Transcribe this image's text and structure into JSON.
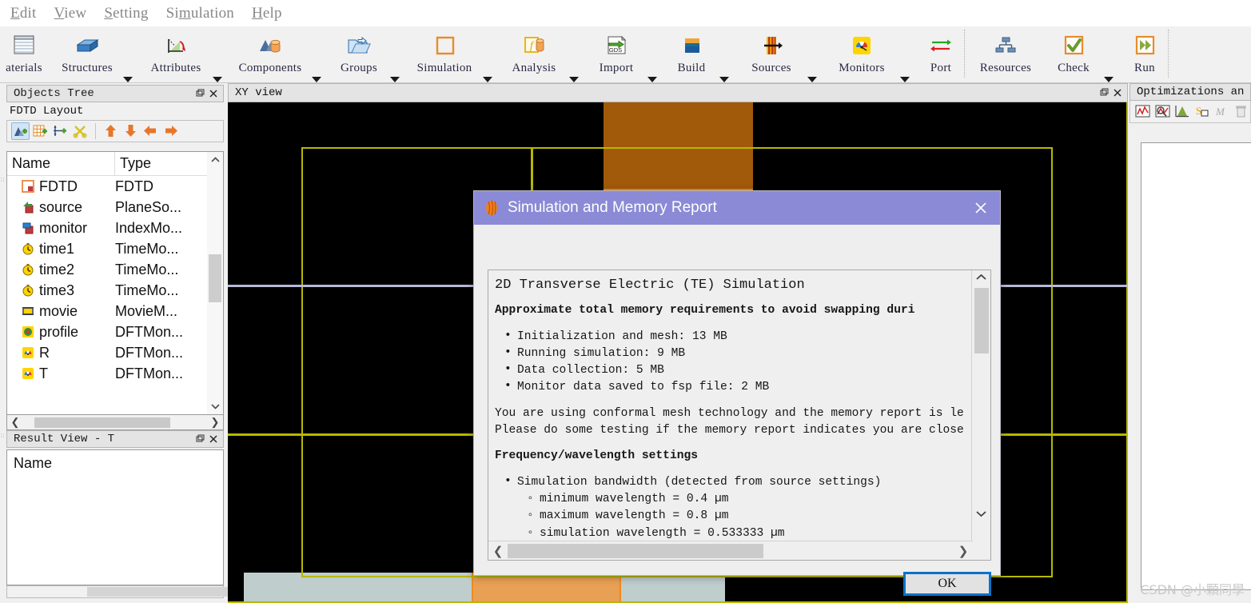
{
  "menu": {
    "items": [
      {
        "label": "Edit",
        "mnemonic": "E"
      },
      {
        "label": "View",
        "mnemonic": "V"
      },
      {
        "label": "Setting",
        "mnemonic": "S"
      },
      {
        "label": "Simulation",
        "mnemonic": "m"
      },
      {
        "label": "Help",
        "mnemonic": "H"
      }
    ]
  },
  "ribbon": {
    "buttons": [
      {
        "label": "aterials",
        "icon": "materials-icon",
        "caret": false
      },
      {
        "label": "Structures",
        "icon": "structures-icon",
        "caret": true
      },
      {
        "label": "Attributes",
        "icon": "attributes-icon",
        "caret": true
      },
      {
        "label": "Components",
        "icon": "components-icon",
        "caret": true
      },
      {
        "label": "Groups",
        "icon": "groups-icon",
        "caret": true
      },
      {
        "label": "Simulation",
        "icon": "simulation-region-icon",
        "caret": true
      },
      {
        "label": "Analysis",
        "icon": "analysis-icon",
        "caret": true
      },
      {
        "label": "Import",
        "icon": "import-gds-icon",
        "caret": true
      },
      {
        "label": "Build",
        "icon": "build-icon",
        "caret": true
      },
      {
        "label": "Sources",
        "icon": "sources-icon",
        "caret": true
      },
      {
        "label": "Monitors",
        "icon": "monitors-icon",
        "caret": true
      },
      {
        "label": "Port",
        "icon": "port-icon",
        "caret": false
      },
      {
        "label": "Resources",
        "icon": "resources-icon",
        "caret": false
      },
      {
        "label": "Check",
        "icon": "check-icon",
        "caret": true
      },
      {
        "label": "Run",
        "icon": "run-icon",
        "caret": false
      }
    ]
  },
  "objects_tree": {
    "title": "Objects Tree",
    "subtitle": "FDTD Layout",
    "toolbar": [
      {
        "icon": "add-object-icon",
        "selected": true
      },
      {
        "icon": "add-mesh-icon",
        "selected": false
      },
      {
        "icon": "add-dimension-icon",
        "selected": false
      },
      {
        "icon": "cut-icon",
        "selected": false
      },
      {
        "icon": "move-up-icon",
        "selected": false
      },
      {
        "icon": "move-down-icon",
        "selected": false
      },
      {
        "icon": "move-left-icon",
        "selected": false
      },
      {
        "icon": "move-right-icon",
        "selected": false
      }
    ],
    "columns": [
      "Name",
      "Type"
    ],
    "rows": [
      {
        "name": "FDTD",
        "type": "FDTD",
        "icon": "fdtd-region-icon"
      },
      {
        "name": "source",
        "type": "PlaneSo...",
        "icon": "plane-source-icon"
      },
      {
        "name": "monitor",
        "type": "IndexMo...",
        "icon": "index-monitor-icon"
      },
      {
        "name": "time1",
        "type": "TimeMo...",
        "icon": "time-monitor-icon"
      },
      {
        "name": "time2",
        "type": "TimeMo...",
        "icon": "time-monitor-icon"
      },
      {
        "name": "time3",
        "type": "TimeMo...",
        "icon": "time-monitor-icon"
      },
      {
        "name": "movie",
        "type": "MovieM...",
        "icon": "movie-monitor-icon"
      },
      {
        "name": "profile",
        "type": "DFTMon...",
        "icon": "profile-monitor-icon"
      },
      {
        "name": "R",
        "type": "DFTMon...",
        "icon": "dft-monitor-icon"
      },
      {
        "name": "T",
        "type": "DFTMon...",
        "icon": "dft-monitor-icon"
      }
    ]
  },
  "result_view": {
    "title": "Result View - T",
    "column": "Name"
  },
  "xy_view": {
    "title": "XY view"
  },
  "optimizations": {
    "title": "Optimizations an",
    "toolbar": [
      {
        "icon": "plot-line-icon"
      },
      {
        "icon": "plot-image-icon"
      },
      {
        "icon": "plot-area-icon"
      },
      {
        "icon": "script-icon"
      },
      {
        "icon": "plot-multi-icon"
      },
      {
        "icon": "delete-icon"
      }
    ]
  },
  "dialog": {
    "title": "Simulation and Memory Report",
    "icon": "lumerical-icon",
    "close_label": "✕",
    "ok_label": "OK",
    "report": {
      "heading": "2D Transverse Electric (TE) Simulation",
      "memory_intro": "Approximate total memory requirements to avoid swapping duri",
      "memory_items": [
        "Initialization and mesh: 13 MB",
        "Running simulation: 9 MB",
        "Data collection: 5 MB",
        "Monitor data saved to fsp file: 2 MB"
      ],
      "note_line1": "You are using conformal mesh technology and the memory report is le",
      "note_line2": "Please do some testing if the memory report indicates you are close",
      "freq_heading": "Frequency/wavelength settings",
      "bandwidth_item": "Simulation bandwidth (detected from source settings)",
      "bandwidth_sub": [
        "minimum wavelength = 0.4 µm",
        "maximum wavelength = 0.8 µm",
        "simulation wavelength = 0.533333 µm"
      ]
    }
  },
  "watermark": {
    "text": "CSDN @小顆同學"
  },
  "colors": {
    "dialog_title_bg": "#8a8ad6",
    "fdtd_outline": "#b8b800",
    "canvas_bg": "#000000",
    "structure_orange": "#e8a055",
    "structure_brown": "#a05a0a",
    "structure_gray": "#bfcdcd",
    "ok_border": "#0a72c9",
    "ribbon_bg": "#f1f1f1"
  }
}
